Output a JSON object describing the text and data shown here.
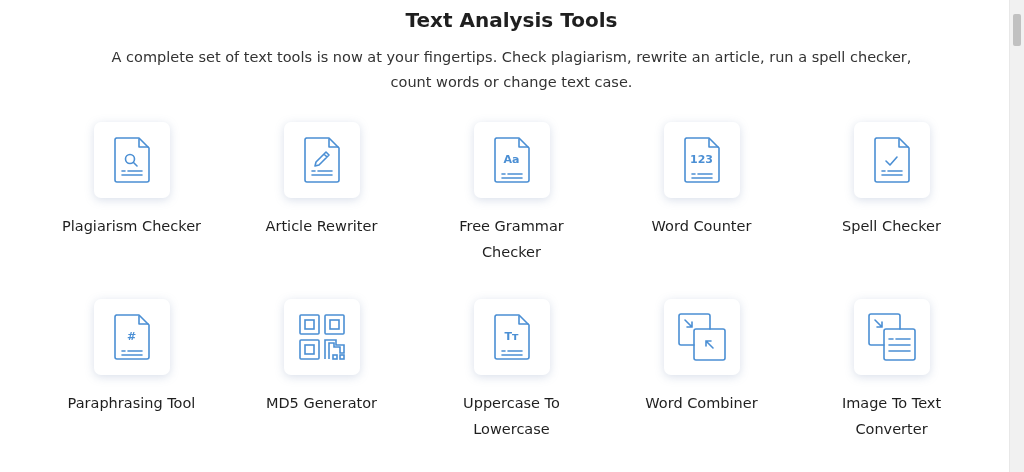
{
  "title": "Text Analysis Tools",
  "intro": "A complete set of text tools is now at your fingertips. Check plagiarism, rewrite an article, run a spell checker, count words or change text case.",
  "tools": [
    {
      "label": "Plagiarism Checker",
      "kind": "search"
    },
    {
      "label": "Article Rewriter",
      "kind": "pencil"
    },
    {
      "label": "Free Grammar Checker",
      "kind": "glyph",
      "glyph": "Aa"
    },
    {
      "label": "Word Counter",
      "kind": "glyph",
      "glyph": "123"
    },
    {
      "label": "Spell Checker",
      "kind": "check"
    },
    {
      "label": "Paraphrasing Tool",
      "kind": "glyph",
      "glyph": "#"
    },
    {
      "label": "MD5 Generator",
      "kind": "qr"
    },
    {
      "label": "Uppercase To Lowercase",
      "kind": "glyph",
      "glyph": "Tт"
    },
    {
      "label": "Word Combiner",
      "kind": "combine"
    },
    {
      "label": "Image To Text Converter",
      "kind": "convert"
    }
  ]
}
